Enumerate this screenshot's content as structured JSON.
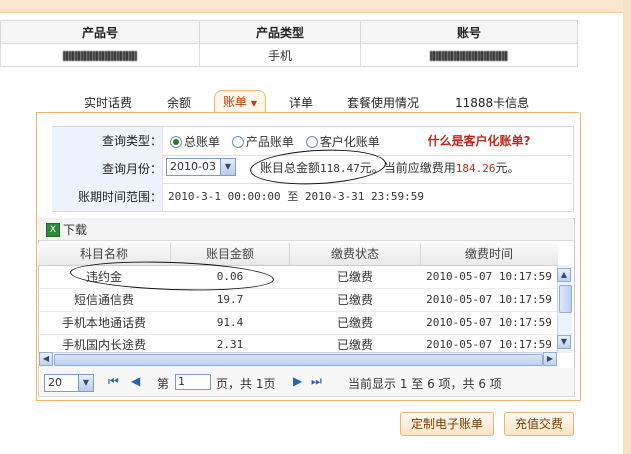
{
  "top_table": {
    "headers": [
      "产品号",
      "产品类型",
      "账号"
    ],
    "row": {
      "product_type": "手机"
    }
  },
  "tabs": [
    {
      "label": "实时话费"
    },
    {
      "label": "余额"
    },
    {
      "label": "账单",
      "active": true
    },
    {
      "label": "详单"
    },
    {
      "label": "套餐使用情况"
    },
    {
      "label": "11888卡信息"
    }
  ],
  "query": {
    "type_label": "查询类型：",
    "type_options": [
      "总账单",
      "产品账单",
      "客户化账单"
    ],
    "type_selected": "总账单",
    "help_link": "什么是客户化账单?",
    "month_label": "查询月份：",
    "month_value": "2010-03",
    "summary_prefix": "账目总金额",
    "summary_total": "118.47",
    "summary_mid": "元。当前应缴费用",
    "summary_due": "184.26",
    "summary_suffix": "元。",
    "range_label": "账期时间范围：",
    "range_value": "2010-3-1 00:00:00 至 2010-3-31 23:59:59"
  },
  "grid": {
    "download_label": "下载",
    "columns": [
      "科目名称",
      "账目金额",
      "缴费状态",
      "缴费时间"
    ],
    "rows": [
      [
        "违约金",
        "0.06",
        "已缴费",
        "2010-05-07 10:17:59"
      ],
      [
        "短信通信费",
        "19.7",
        "已缴费",
        "2010-05-07 10:17:59"
      ],
      [
        "手机本地通话费",
        "91.4",
        "已缴费",
        "2010-05-07 10:17:59"
      ],
      [
        "手机国内长途费",
        "2.31",
        "已缴费",
        "2010-05-07 10:17:59"
      ]
    ]
  },
  "pager": {
    "page_size": "20",
    "page_prefix": "第",
    "page_value": "1",
    "page_suffix": "页，共 1页",
    "status": "当前显示 1 至 6 项，共 6 项"
  },
  "buttons": {
    "custom_bill": "定制电子账单",
    "recharge": "充值交费"
  }
}
